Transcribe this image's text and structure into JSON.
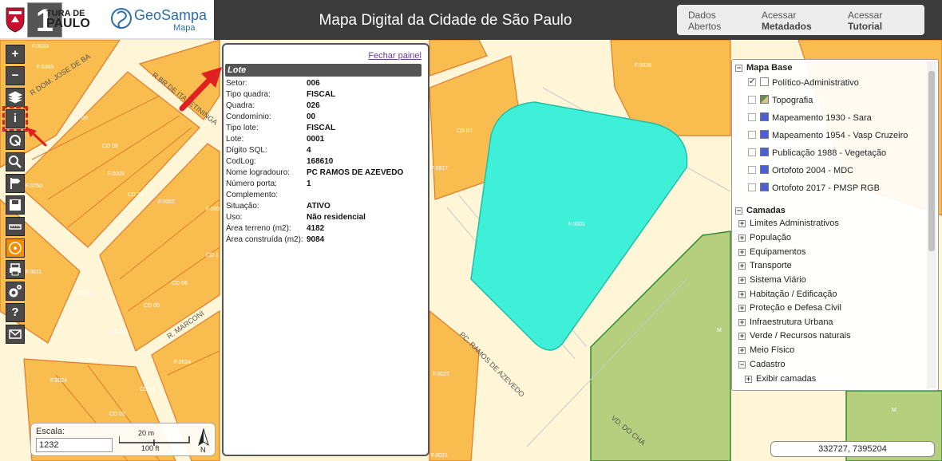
{
  "header": {
    "prefeitura_line1": "TURA DE",
    "prefeitura_line2": "PAULO",
    "brand_name": "GeoSampa",
    "brand_sub": "Mapa",
    "step_number": "1",
    "title": "Mapa Digital da Cidade de São Paulo",
    "links": [
      {
        "line1": "Dados",
        "line2": "Abertos"
      },
      {
        "line1": "Acessar",
        "line2": "Metadados"
      },
      {
        "line1": "Acessar",
        "line2": "Tutorial"
      }
    ]
  },
  "toolbar": {
    "zoom_in": "+",
    "zoom_out": "−",
    "info": "i",
    "help": "?"
  },
  "info_panel": {
    "close_label": "Fechar painel",
    "heading": "Lote",
    "rows": [
      {
        "label": "Setor:",
        "value": "006"
      },
      {
        "label": "Tipo quadra:",
        "value": "FISCAL"
      },
      {
        "label": "Quadra:",
        "value": "026"
      },
      {
        "label": "Condomínio:",
        "value": "00"
      },
      {
        "label": "Tipo lote:",
        "value": "FISCAL"
      },
      {
        "label": "Lote:",
        "value": "0001"
      },
      {
        "label": "Dígito SQL:",
        "value": "4"
      },
      {
        "label": "CodLog:",
        "value": "168610"
      },
      {
        "label": "Nome logradouro:",
        "value": "PC RAMOS DE AZEVEDO"
      },
      {
        "label": "Número porta:",
        "value": "1"
      },
      {
        "label": "Complemento:",
        "value": ""
      },
      {
        "label": "Situação:",
        "value": "ATIVO"
      },
      {
        "label": "Uso:",
        "value": "Não residencial"
      },
      {
        "label": "Área terreno (m2):",
        "value": "4182"
      },
      {
        "label": "Área construída (m2):",
        "value": "9084"
      }
    ]
  },
  "layers": {
    "base_title": "Mapa Base",
    "base_items": [
      {
        "label": "Político-Administrativo",
        "checked": true,
        "swatch": "white"
      },
      {
        "label": "Topografia",
        "checked": false,
        "swatch": "topo"
      },
      {
        "label": "Mapeamento 1930 - Sara",
        "checked": false,
        "swatch": "blue"
      },
      {
        "label": "Mapeamento 1954 - Vasp Cruzeiro",
        "checked": false,
        "swatch": "blue"
      },
      {
        "label": "Publicação 1988 - Vegetação",
        "checked": false,
        "swatch": "blue"
      },
      {
        "label": "Ortofoto 2004 - MDC",
        "checked": false,
        "swatch": "blue"
      },
      {
        "label": "Ortofoto 2017 - PMSP RGB",
        "checked": false,
        "swatch": "blue"
      }
    ],
    "layers_title": "Camadas",
    "layer_items": [
      "Limites Administrativos",
      "População",
      "Equipamentos",
      "Transporte",
      "Sistema Viário",
      "Habitação / Edificação",
      "Proteção e Defesa Civil",
      "Infraestrutura Urbana",
      "Verde / Recursos naturais",
      "Meio Físico",
      "Cadastro"
    ],
    "sub_item": "Exibir camadas"
  },
  "map_labels": {
    "streets": [
      "R DOM. JOSE DE BA",
      "R BR DE ITAPETININGA",
      "R. MARCONI",
      "PC. RAMOS DE AZEVEDO",
      "VD. DO CHA"
    ],
    "lots": [
      "F.0033",
      "F.0368",
      "CD 09",
      "CD 08",
      "F.0005",
      "CD 12",
      "F.0002",
      "F.000",
      "CD 07",
      "F.0817",
      "F.0026",
      "F.0001",
      "CD 1",
      "CD 06",
      "CD 05",
      "CD 02",
      "CD 04",
      "CD 03",
      "F.0024",
      "F.0024",
      "CD 05",
      "CD 02",
      "F.0022",
      "F.0021",
      "F.0244",
      "F.0750",
      "F.0011",
      "M",
      "M"
    ]
  },
  "scale": {
    "label": "Escala:",
    "value": "1232",
    "metric": "20 m",
    "imperial": "100 ft",
    "north": "N"
  },
  "coordinates": "332727, 7395204",
  "colors": {
    "lot_fill": "#f9bd4f",
    "lot_border": "#e07a2a",
    "street": "#fff6d8",
    "selected_lot": "#3ff0d8",
    "green_area": "#b5cf7e",
    "header_bg": "#3b3b3b"
  }
}
